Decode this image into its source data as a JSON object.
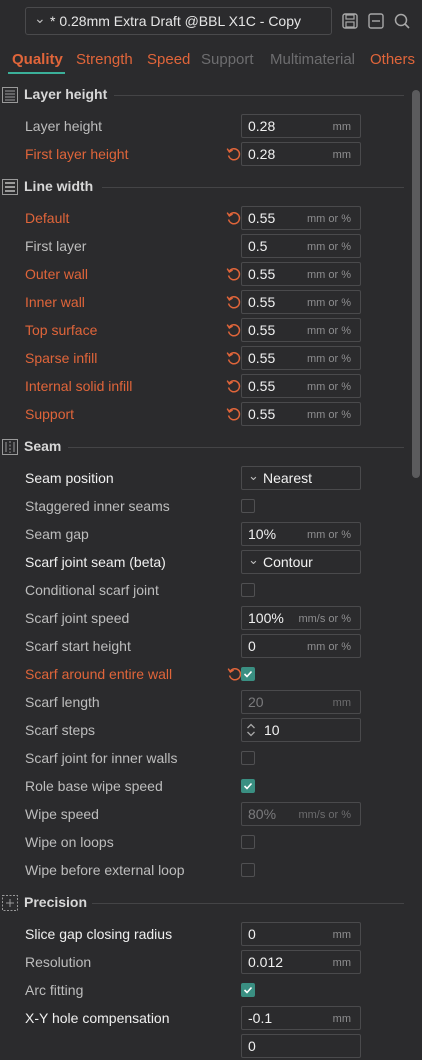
{
  "toolbar": {
    "preset_name": "* 0.28mm Extra Draft @BBL X1C - Copy",
    "icons": [
      "chevron-down-icon",
      "save-icon",
      "compare-icon",
      "search-icon"
    ]
  },
  "tabs": [
    {
      "label": "Quality",
      "state": "active"
    },
    {
      "label": "Strength",
      "state": "normal"
    },
    {
      "label": "Speed",
      "state": "normal"
    },
    {
      "label": "Support",
      "state": "disabled"
    },
    {
      "label": "Multimaterial",
      "state": "disabled"
    },
    {
      "label": "Others",
      "state": "normal"
    }
  ],
  "colors": {
    "accent_orange": "#e0653a",
    "accent_teal": "#3bb09a",
    "checkbox_checked": "#3a8f82",
    "background": "#2b2b2d"
  },
  "sections": {
    "layer_height": {
      "title": "Layer height",
      "rows": [
        {
          "label": "Layer height",
          "value": "0.28",
          "unit": "mm"
        },
        {
          "label": "First layer height",
          "value": "0.28",
          "unit": "mm"
        }
      ]
    },
    "line_width": {
      "title": "Line width",
      "rows": [
        {
          "label": "Default",
          "value": "0.55",
          "unit": "mm or %"
        },
        {
          "label": "First layer",
          "value": "0.5",
          "unit": "mm or %"
        },
        {
          "label": "Outer wall",
          "value": "0.55",
          "unit": "mm or %"
        },
        {
          "label": "Inner wall",
          "value": "0.55",
          "unit": "mm or %"
        },
        {
          "label": "Top surface",
          "value": "0.55",
          "unit": "mm or %"
        },
        {
          "label": "Sparse infill",
          "value": "0.55",
          "unit": "mm or %"
        },
        {
          "label": "Internal solid infill",
          "value": "0.55",
          "unit": "mm or %"
        },
        {
          "label": "Support",
          "value": "0.55",
          "unit": "mm or %"
        }
      ]
    },
    "seam": {
      "title": "Seam",
      "rows": [
        {
          "label": "Seam position",
          "value": "Nearest"
        },
        {
          "label": "Staggered inner seams",
          "checked": false
        },
        {
          "label": "Seam gap",
          "value": "10%",
          "unit": "mm or %"
        },
        {
          "label": "Scarf joint seam (beta)",
          "value": "Contour"
        },
        {
          "label": "Conditional scarf joint",
          "checked": false
        },
        {
          "label": "Scarf joint speed",
          "value": "100%",
          "unit": "mm/s or %"
        },
        {
          "label": "Scarf start height",
          "value": "0",
          "unit": "mm or %"
        },
        {
          "label": "Scarf around entire wall",
          "checked": true
        },
        {
          "label": "Scarf length",
          "value": "20",
          "unit": "mm"
        },
        {
          "label": "Scarf steps",
          "value": "10"
        },
        {
          "label": "Scarf joint for inner walls",
          "checked": false
        },
        {
          "label": "Role base wipe speed",
          "checked": true
        },
        {
          "label": "Wipe speed",
          "value": "80%",
          "unit": "mm/s or %"
        },
        {
          "label": "Wipe on loops",
          "checked": false
        },
        {
          "label": "Wipe before external loop",
          "checked": false
        }
      ]
    },
    "precision": {
      "title": "Precision",
      "rows": [
        {
          "label": "Slice gap closing radius",
          "value": "0",
          "unit": "mm"
        },
        {
          "label": "Resolution",
          "value": "0.012",
          "unit": "mm"
        },
        {
          "label": "Arc fitting",
          "checked": true
        },
        {
          "label": "X-Y hole compensation",
          "value": "-0.1",
          "unit": "mm"
        },
        {
          "label": "",
          "value": "0"
        }
      ]
    }
  }
}
